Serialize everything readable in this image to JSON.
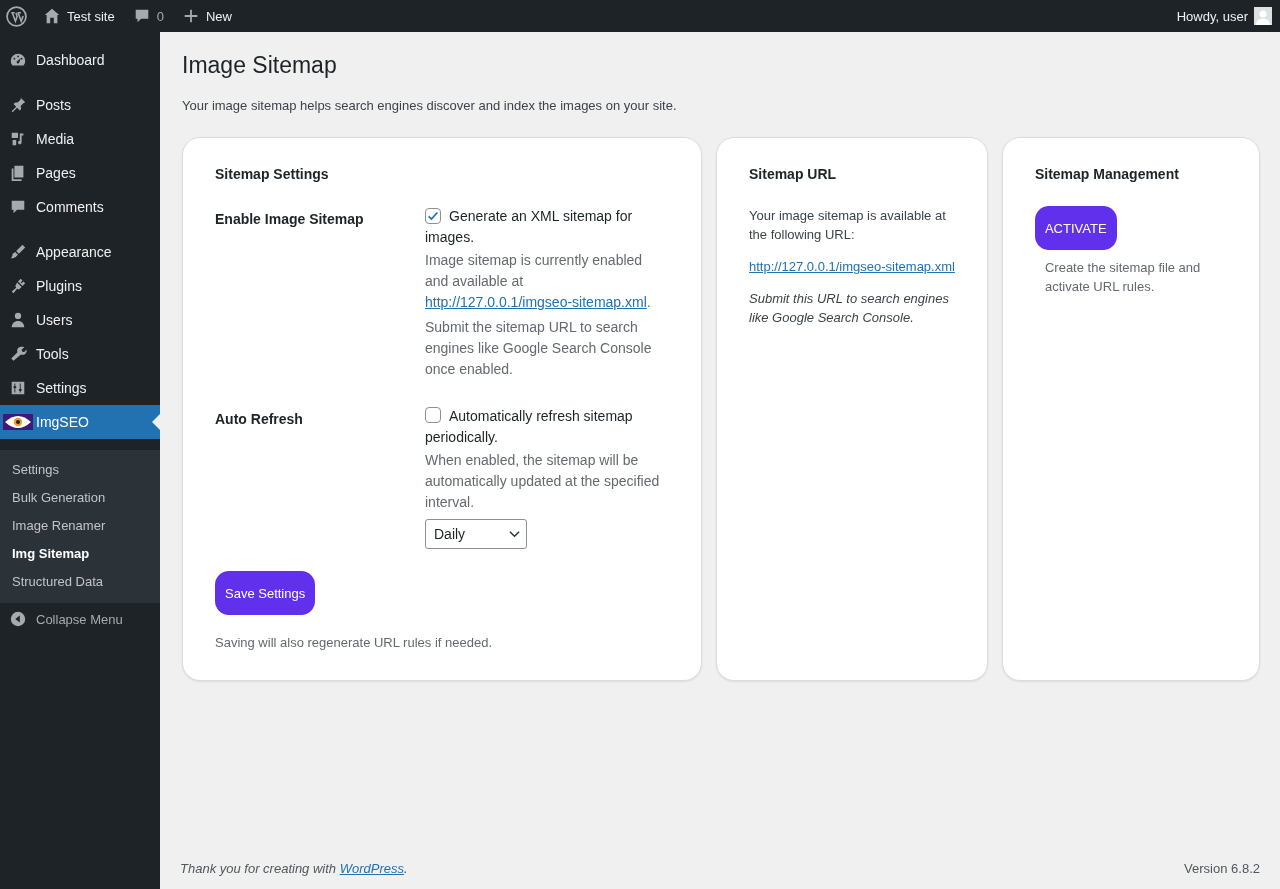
{
  "admin_bar": {
    "site": "Test site",
    "comments": "0",
    "new": "New",
    "greeting": "Howdy, user"
  },
  "sidebar": {
    "groups": [
      [
        {
          "label": "Dashboard",
          "selected": false
        }
      ],
      [
        {
          "label": "Posts",
          "selected": false
        },
        {
          "label": "Media",
          "selected": false
        },
        {
          "label": "Pages",
          "selected": false
        },
        {
          "label": "Comments",
          "selected": false
        }
      ],
      [
        {
          "label": "Appearance",
          "selected": false
        },
        {
          "label": "Plugins",
          "selected": false
        },
        {
          "label": "Users",
          "selected": false
        },
        {
          "label": "Tools",
          "selected": false
        },
        {
          "label": "Settings",
          "selected": false
        },
        {
          "label": "ImgSEO",
          "selected": true
        }
      ]
    ],
    "submenu": [
      {
        "label": "Settings",
        "selected": false
      },
      {
        "label": "Bulk Generation",
        "selected": false
      },
      {
        "label": "Image Renamer",
        "selected": false
      },
      {
        "label": "Img Sitemap",
        "selected": true
      },
      {
        "label": "Structured Data",
        "selected": false
      }
    ],
    "collapse": "Collapse Menu"
  },
  "page": {
    "title": "Image Sitemap",
    "intro": "Your image sitemap helps search engines discover and index the images on your site."
  },
  "settings_card": {
    "title": "Sitemap Settings",
    "fields": [
      {
        "label": "Enable Image Sitemap",
        "checkbox": {
          "label": "Generate an XML sitemap for images.",
          "checked": true
        },
        "status_before": "Image sitemap is currently enabled and available at",
        "status_link": "http://127.0.0.1/imgseo-sitemap.xml",
        "status_after": ".",
        "description": "Submit the sitemap URL to search engines like Google Search Console once enabled."
      },
      {
        "label": "Auto Refresh",
        "checkbox": {
          "label": "Automatically refresh sitemap periodically.",
          "checked": false
        },
        "description": "When enabled, the sitemap will be automatically updated at the specified interval.",
        "select": "Daily"
      }
    ],
    "save_button": "Save Settings",
    "note": "Saving will also regenerate URL rules if needed."
  },
  "url_card": {
    "title": "Sitemap URL",
    "text": "Your image sitemap is available at the following URL:",
    "link": "http://127.0.0.1/imgseo-sitemap.xml",
    "note": "Submit this URL to search engines like Google Search Console."
  },
  "management_card": {
    "title": "Sitemap Management",
    "button": "ACTIVATE",
    "description": "Create the sitemap file and activate URL rules."
  },
  "footer": {
    "before": "Thank you for creating with ",
    "link": "WordPress",
    "after": ".",
    "version": "Version 6.8.2"
  }
}
